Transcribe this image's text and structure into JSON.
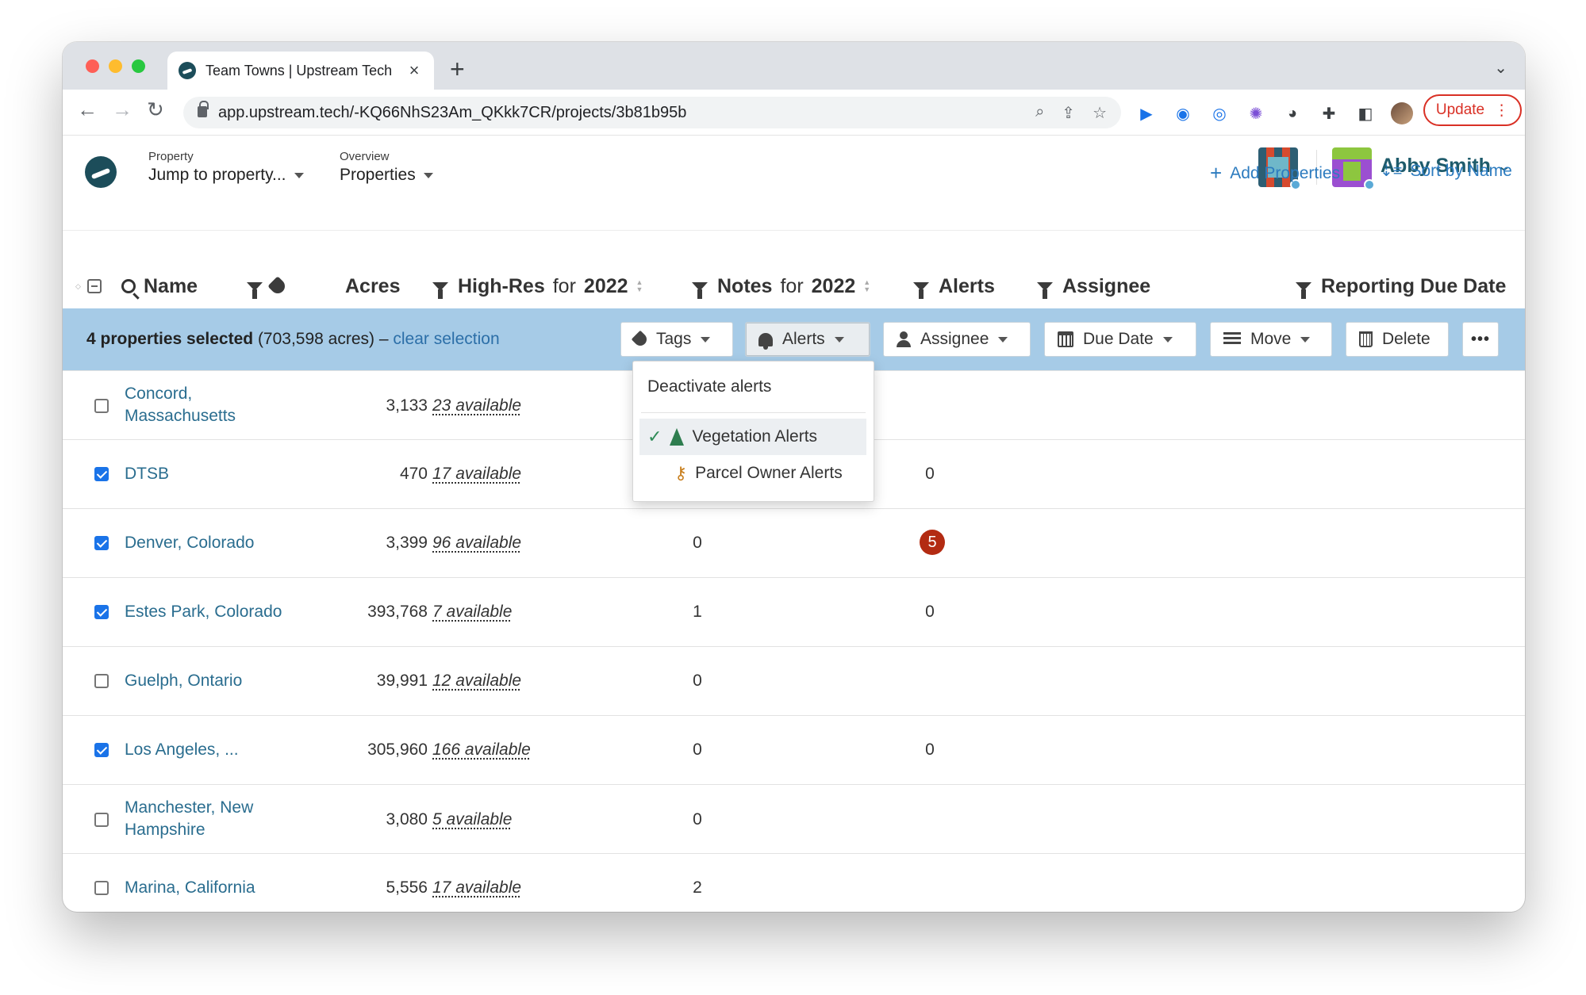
{
  "browser": {
    "tab_title": "Team Towns | Upstream Tech",
    "tab_close": "×",
    "new_tab": "+",
    "url": "app.upstream.tech/-KQ66NhS23Am_QKkk7CR/projects/3b81b95b",
    "update_label": "Update",
    "menu_glyph": "⋮"
  },
  "header": {
    "property_label": "Property",
    "property_value": "Jump to property...",
    "overview_label": "Overview",
    "overview_value": "Properties",
    "user_name": "Abby Smith"
  },
  "actions": {
    "add_properties": "Add Properties",
    "sort_by_name": "Sort by Name"
  },
  "columns": {
    "name": "Name",
    "acres": "Acres",
    "high_res_bold": "High-Res",
    "high_res_light": "for",
    "high_res_year": "2022",
    "notes_bold": "Notes",
    "notes_light": "for",
    "notes_year": "2022",
    "alerts": "Alerts",
    "assignee": "Assignee",
    "reporting_due_date": "Reporting Due Date"
  },
  "selection": {
    "count_text": "4 properties selected",
    "acres_text": "(703,598 acres) –",
    "clear_text": "clear selection"
  },
  "bulk_actions": {
    "tags": "Tags",
    "alerts": "Alerts",
    "assignee": "Assignee",
    "due_date": "Due Date",
    "move": "Move",
    "delete": "Delete",
    "more": "•••"
  },
  "alerts_menu": {
    "deactivate": "Deactivate alerts",
    "vegetation": "Vegetation Alerts",
    "parcel_owner": "Parcel Owner Alerts"
  },
  "rows": [
    {
      "name": "Concord, Massachusetts",
      "checked": false,
      "acres": "3,133",
      "high_res": "23 available",
      "notes": "",
      "alerts": ""
    },
    {
      "name": "DTSB",
      "checked": true,
      "acres": "470",
      "high_res": "17 available",
      "notes": "",
      "alerts": "0"
    },
    {
      "name": "Denver, Colorado",
      "checked": true,
      "acres": "3,399",
      "high_res": "96 available",
      "notes": "0",
      "alerts_badge": "5"
    },
    {
      "name": "Estes Park, Colorado",
      "checked": true,
      "acres": "393,768",
      "high_res": "7 available",
      "notes": "1",
      "alerts": "0"
    },
    {
      "name": "Guelph, Ontario",
      "checked": false,
      "acres": "39,991",
      "high_res": "12 available",
      "notes": "0",
      "alerts": ""
    },
    {
      "name": "Los Angeles, ...",
      "checked": true,
      "acres": "305,960",
      "high_res": "166 available",
      "notes": "0",
      "alerts": "0"
    },
    {
      "name": "Manchester, New Hampshire",
      "checked": false,
      "acres": "3,080",
      "high_res": "5 available",
      "notes": "0",
      "alerts": ""
    },
    {
      "name": "Marina, California",
      "checked": false,
      "acres": "5,556",
      "high_res": "17 available",
      "notes": "2",
      "alerts": ""
    }
  ],
  "colors": {
    "selection_bar": "#a6cbe7",
    "link": "#2a6d8f",
    "alert_badge": "#b32b12",
    "update": "#d93025"
  }
}
